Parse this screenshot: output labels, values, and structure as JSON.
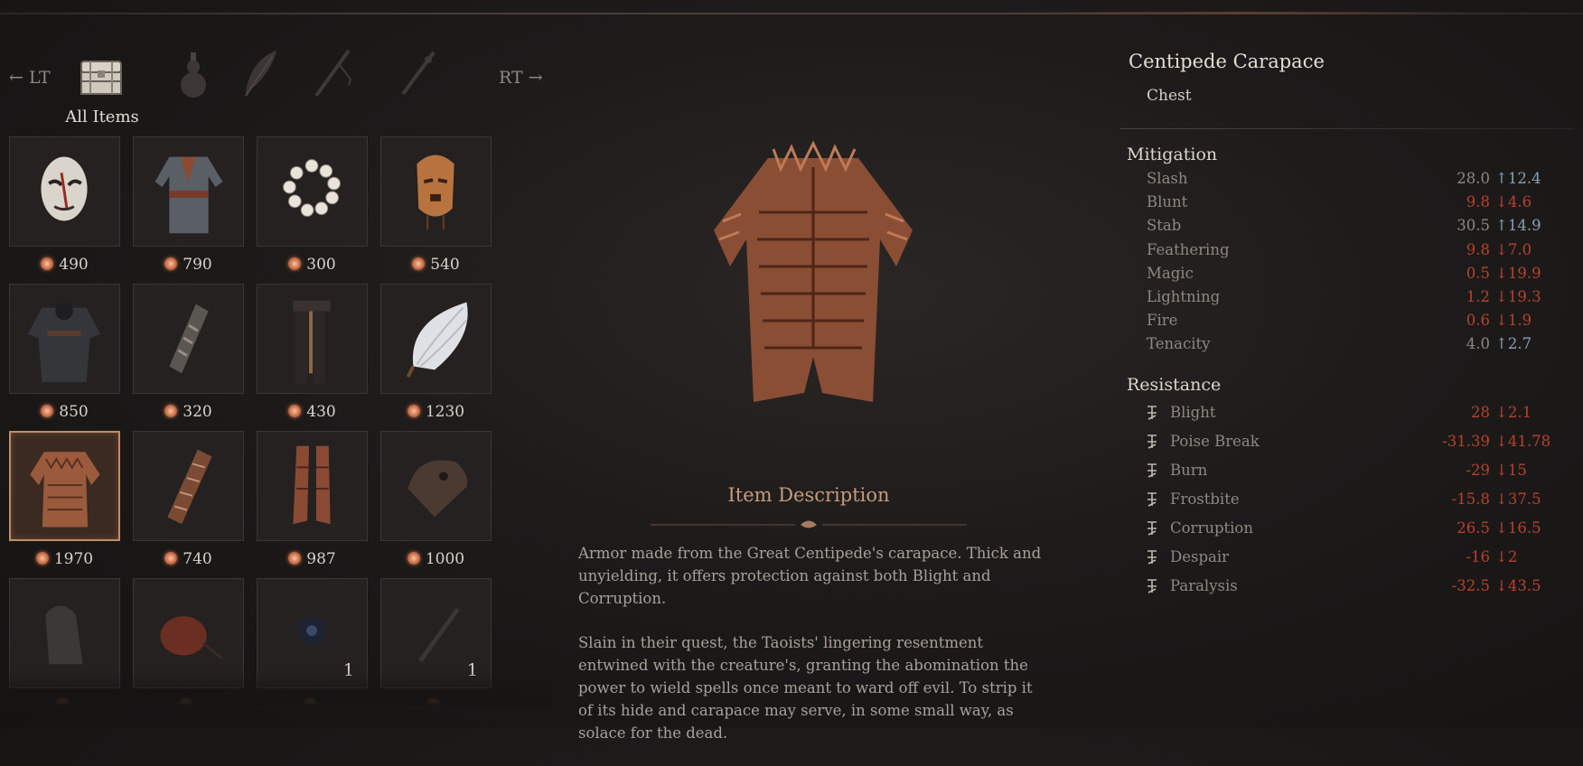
{
  "nav": {
    "left": "LT",
    "right": "RT"
  },
  "tabs": [
    {
      "icon": "treasure-chest-icon",
      "label": "All Items",
      "active": true
    },
    {
      "icon": "gourd-icon"
    },
    {
      "icon": "feather-icon"
    },
    {
      "icon": "staff-icon"
    },
    {
      "icon": "dagger-icon"
    }
  ],
  "inventory": [
    {
      "icon": "white-mask-icon",
      "price": "490"
    },
    {
      "icon": "robe-armor-icon",
      "price": "790"
    },
    {
      "icon": "prayer-beads-icon",
      "price": "300"
    },
    {
      "icon": "wooden-mask-icon",
      "price": "540"
    },
    {
      "icon": "dark-cloak-icon",
      "price": "850"
    },
    {
      "icon": "bracer-icon",
      "price": "320"
    },
    {
      "icon": "leggings-icon",
      "price": "430"
    },
    {
      "icon": "white-fan-icon",
      "price": "1230"
    },
    {
      "icon": "centipede-carapace-icon",
      "price": "1970",
      "selected": true
    },
    {
      "icon": "claw-bracer-icon",
      "price": "740"
    },
    {
      "icon": "boots-icon",
      "price": "987"
    },
    {
      "icon": "beaked-mask-icon",
      "price": "1000"
    },
    {
      "icon": "stone-figure-icon",
      "price": ""
    },
    {
      "icon": "red-gourd-icon",
      "price": ""
    },
    {
      "icon": "dark-orb-icon",
      "price": "",
      "qty": "1"
    },
    {
      "icon": "blade-icon",
      "price": "",
      "qty": "1"
    }
  ],
  "item": {
    "name": "Centipede Carapace",
    "type": "Chest"
  },
  "mitigation": {
    "title": "Mitigation",
    "rows": [
      {
        "label": "Slash",
        "value": "28.0",
        "diff": "↑12.4",
        "trend": "up"
      },
      {
        "label": "Blunt",
        "value": "9.8",
        "diff": "↓4.6",
        "trend": "down"
      },
      {
        "label": "Stab",
        "value": "30.5",
        "diff": "↑14.9",
        "trend": "up"
      },
      {
        "label": "Feathering",
        "value": "9.8",
        "diff": "↓7.0",
        "trend": "down"
      },
      {
        "label": "Magic",
        "value": "0.5",
        "diff": "↓19.9",
        "trend": "down"
      },
      {
        "label": "Lightning",
        "value": "1.2",
        "diff": "↓19.3",
        "trend": "down"
      },
      {
        "label": "Fire",
        "value": "0.6",
        "diff": "↓1.9",
        "trend": "down"
      },
      {
        "label": "Tenacity",
        "value": "4.0",
        "diff": "↑2.7",
        "trend": "up"
      }
    ]
  },
  "resistance": {
    "title": "Resistance",
    "rows": [
      {
        "icon": "blight-icon",
        "label": "Blight",
        "value": "28",
        "diff": "↓2.1"
      },
      {
        "icon": "poise-break-icon",
        "label": "Poise Break",
        "value": "-31.39",
        "diff": "↓41.78"
      },
      {
        "icon": "burn-icon",
        "label": "Burn",
        "value": "-29",
        "diff": "↓15"
      },
      {
        "icon": "frostbite-icon",
        "label": "Frostbite",
        "value": "-15.8",
        "diff": "↓37.5"
      },
      {
        "icon": "corruption-icon",
        "label": "Corruption",
        "value": "26.5",
        "diff": "↓16.5"
      },
      {
        "icon": "despair-icon",
        "label": "Despair",
        "value": "-16",
        "diff": "↓2"
      },
      {
        "icon": "paralysis-icon",
        "label": "Paralysis",
        "value": "-32.5",
        "diff": "↓43.5"
      }
    ]
  },
  "description": {
    "title": "Item Description",
    "paragraphs": [
      "Armor made from the Great Centipede's carapace. Thick and unyielding, it offers protection against both Blight and Corruption.",
      "Slain in their quest, the Taoists' lingering resentment entwined with the creature's, granting the abomination the power to wield spells once meant to ward off evil. To strip it of its hide and carapace may serve, in some small way, as solace for the dead."
    ]
  },
  "colors": {
    "up": "#8a9fb4",
    "down": "#b8412e",
    "selected_border": "#c08c6a"
  }
}
